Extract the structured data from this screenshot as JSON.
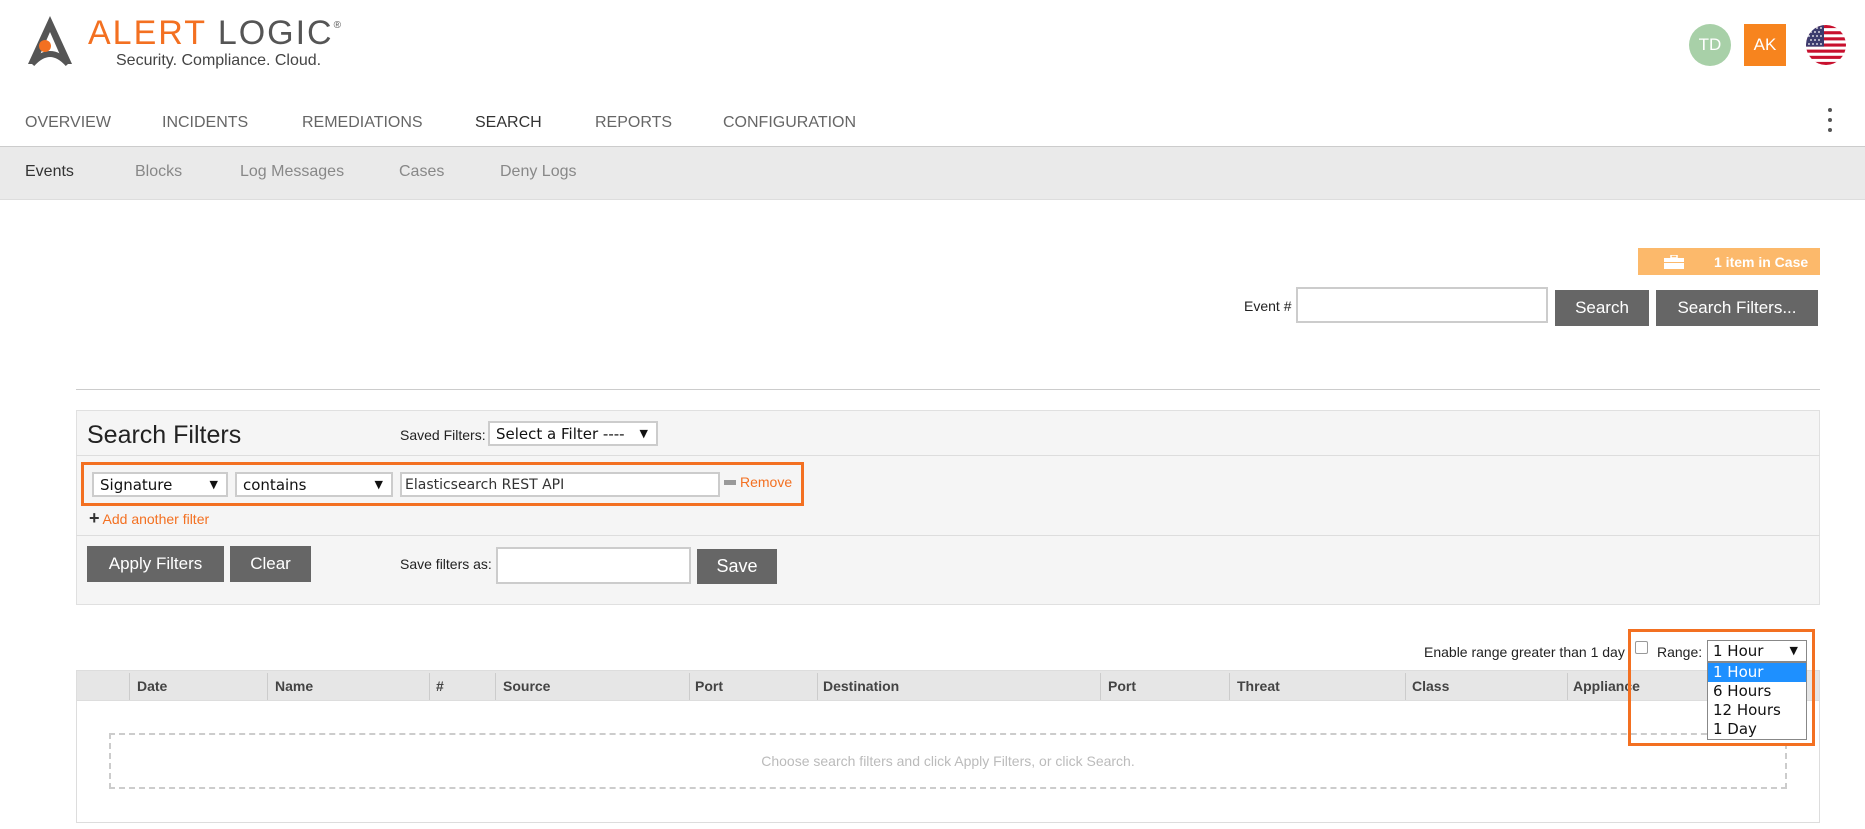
{
  "header": {
    "brand_word1": "ALERT",
    "brand_word2": "LOGIC",
    "registered": "®",
    "tagline": "Security. Compliance. Cloud.",
    "user_initials_1": "TD",
    "user_initials_2": "AK",
    "accent_color": "#f37021"
  },
  "main_nav": [
    {
      "label": "OVERVIEW"
    },
    {
      "label": "INCIDENTS"
    },
    {
      "label": "REMEDIATIONS"
    },
    {
      "label": "SEARCH",
      "active": true
    },
    {
      "label": "REPORTS"
    },
    {
      "label": "CONFIGURATION"
    }
  ],
  "sub_nav": [
    {
      "label": "Events",
      "active": true
    },
    {
      "label": "Blocks"
    },
    {
      "label": "Log Messages"
    },
    {
      "label": "Cases"
    },
    {
      "label": "Deny Logs"
    }
  ],
  "case": {
    "label": "1 item in Case",
    "icon": "briefcase-icon"
  },
  "event_search": {
    "label": "Event #",
    "value": "",
    "search_label": "Search",
    "filters_label": "Search Filters..."
  },
  "filters": {
    "title": "Search Filters",
    "saved_label": "Saved Filters:",
    "saved_value": "Select a Filter ----",
    "field_value": "Signature",
    "operator_value": "contains",
    "text_value": "Elasticsearch REST API",
    "remove_label": "Remove",
    "add_label": "Add another filter",
    "apply_label": "Apply Filters",
    "clear_label": "Clear",
    "save_as_label": "Save filters as:",
    "save_as_value": "",
    "save_label": "Save"
  },
  "range": {
    "enable_label": "Enable range greater than 1 day",
    "enable_checked": false,
    "range_label": "Range:",
    "selected": "1 Hour",
    "options": [
      "1 Hour",
      "6 Hours",
      "12 Hours",
      "1 Day"
    ]
  },
  "table": {
    "columns": [
      "Date",
      "Name",
      "#",
      "Source",
      "Port",
      "Destination",
      "Port",
      "Threat",
      "Class",
      "Appliance"
    ],
    "empty_message": "Choose search filters and click Apply Filters, or click Search."
  }
}
